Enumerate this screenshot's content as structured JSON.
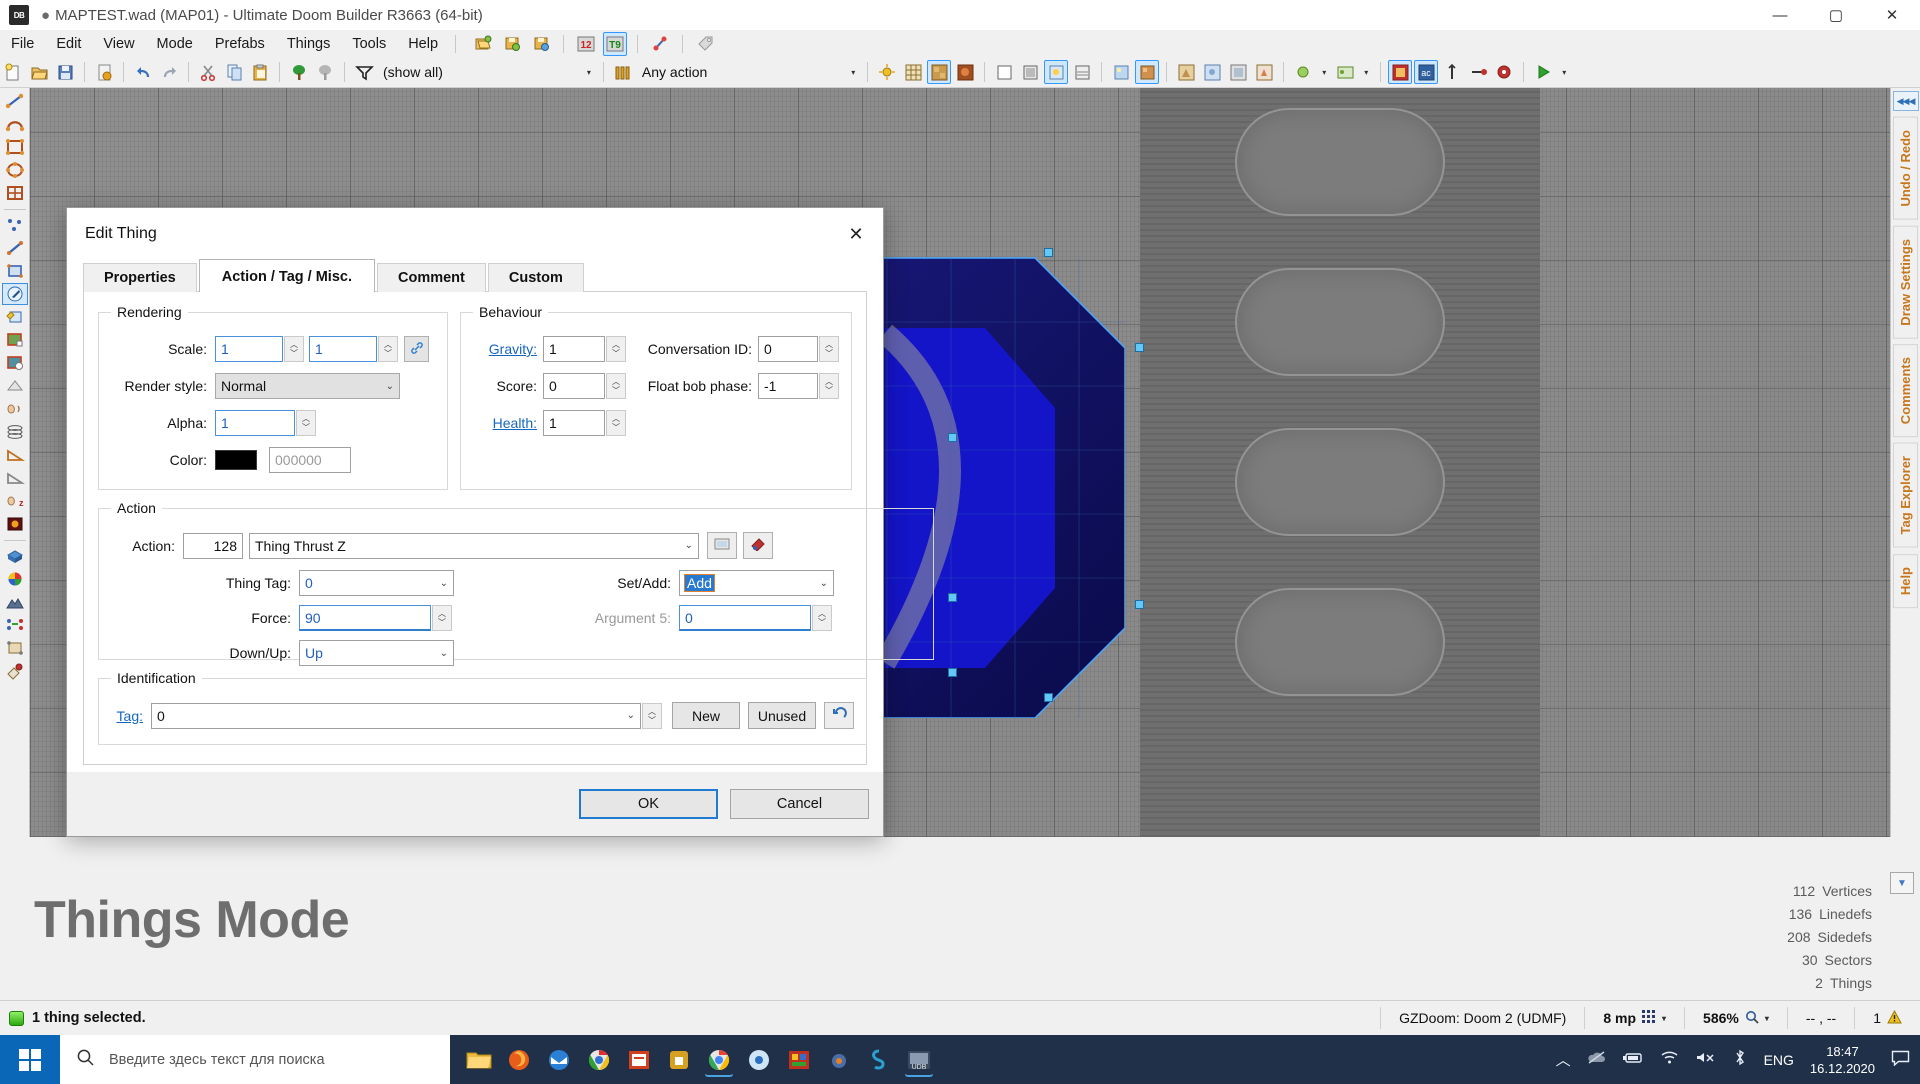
{
  "window": {
    "title": "MAPTEST.wad (MAP01) - Ultimate Doom Builder R3663 (64-bit)",
    "modified_dot": "●",
    "app_badge": "DB",
    "minimize": "—",
    "maximize": "▢",
    "close": "✕"
  },
  "menu": {
    "items": [
      "File",
      "Edit",
      "View",
      "Mode",
      "Prefabs",
      "Things",
      "Tools",
      "Help"
    ],
    "icons": [
      "open-map-icon",
      "save-map-icon",
      "save-map-as-icon",
      "linedefs-mode-icon",
      "things-mode-icon",
      "vertices-mode-icon",
      "tag-icon"
    ]
  },
  "toolbar": {
    "filter_label": "(show all)",
    "action_label": "Any action",
    "icons": [
      "new-map-icon",
      "open-map-icon",
      "save-map-icon",
      "map-options-icon",
      "undo-icon",
      "redo-icon",
      "cut-icon",
      "copy-icon",
      "paste-icon",
      "snap-to-grid-icon",
      "snap-to-things-icon",
      "filter-icon"
    ]
  },
  "left_rail": {
    "tools": [
      "draw-line-icon",
      "draw-curve-icon",
      "draw-rectangle-icon",
      "draw-ellipse-icon",
      "draw-grid-icon",
      "vertices-mode-icon",
      "linedefs-mode-icon",
      "sectors-mode-icon",
      "things-mode-icon",
      "edit-selection-icon",
      "texture-align-x-icon",
      "texture-align-y-icon",
      "flip-icon",
      "sound-propagation-icon",
      "3d-floors-icon",
      "slope-icon",
      "slope-vertices-icon",
      "sound-environment-icon",
      "brightness-icon",
      "visual-mode-icon",
      "color-picker-icon",
      "terrain-icon",
      "copy-properties-icon",
      "resize-icon",
      "stitch-icon"
    ],
    "active_tool": "things-mode-icon"
  },
  "right_rail": {
    "collapse_label": "◀◀◀",
    "tabs": [
      "Undo / Redo",
      "Draw Settings",
      "Comments",
      "Tag Explorer",
      "Help"
    ]
  },
  "map": {
    "mode_text": "Things Mode"
  },
  "counts": [
    {
      "value": "112",
      "label": "Vertices"
    },
    {
      "value": "136",
      "label": "Linedefs"
    },
    {
      "value": "208",
      "label": "Sidedefs"
    },
    {
      "value": "30",
      "label": "Sectors"
    },
    {
      "value": "2",
      "label": "Things"
    }
  ],
  "statusbar": {
    "message": "1 thing selected.",
    "config": "GZDoom: Doom 2 (UDMF)",
    "grid": "8 mp",
    "zoom": "586%",
    "coords": "-- , --",
    "warnings": "1"
  },
  "taskbar": {
    "search_placeholder": "Введите здесь текст для поиска",
    "apps": [
      "file-explorer-icon",
      "firefox-icon",
      "thunderbird-icon",
      "chromium-icon",
      "office-icon",
      "store-icon",
      "chrome-icon",
      "chrome-beta-icon",
      "slade-icon",
      "blender-icon",
      "sketch-icon",
      "doombuilder-icon"
    ],
    "language": "ENG",
    "time": "18:47",
    "date": "16.12.2020",
    "tray_icons": [
      "chevron-up-icon",
      "onedrive-icon",
      "battery-icon",
      "wifi-icon",
      "volume-muted-icon",
      "bluetooth-icon",
      "action-center-icon"
    ]
  },
  "dialog": {
    "title": "Edit Thing",
    "close": "✕",
    "tabs": [
      {
        "label": "Properties",
        "active": false
      },
      {
        "label": "Action / Tag / Misc.",
        "active": true
      },
      {
        "label": "Comment",
        "active": false
      },
      {
        "label": "Custom",
        "active": false
      }
    ],
    "rendering": {
      "legend": "Rendering",
      "scale_label": "Scale:",
      "scale_x": "1",
      "scale_y": "1",
      "link_icon": "link-icon",
      "render_style_label": "Render style:",
      "render_style_value": "Normal",
      "alpha_label": "Alpha:",
      "alpha_value": "1",
      "color_label": "Color:",
      "color_swatch": "#000000",
      "color_hex": "000000"
    },
    "behaviour": {
      "legend": "Behaviour",
      "gravity_label": "Gravity:",
      "gravity_value": "1",
      "score_label": "Score:",
      "score_value": "0",
      "health_label": "Health:",
      "health_value": "1",
      "conversation_label": "Conversation ID:",
      "conversation_value": "0",
      "floatbob_label": "Float bob phase:",
      "floatbob_value": "-1"
    },
    "action": {
      "legend": "Action",
      "action_label": "Action:",
      "action_number": "128",
      "action_name": "Thing Thrust Z",
      "browse_icon": "browse-action-icon",
      "palette_icon": "action-special-icon",
      "args": [
        {
          "label": "Thing Tag:",
          "value": "0",
          "type": "select",
          "dim": false,
          "highlight": false
        },
        {
          "label": "Force:",
          "value": "90",
          "type": "spin",
          "dim": false,
          "highlight": false
        },
        {
          "label": "Down/Up:",
          "value": "Up",
          "type": "select",
          "dim": false,
          "highlight": false
        }
      ],
      "args_right": [
        {
          "label": "Set/Add:",
          "value": "Add",
          "type": "select",
          "dim": false,
          "highlight": true
        },
        {
          "label": "Argument 5:",
          "value": "0",
          "type": "spin",
          "dim": true,
          "highlight": false
        }
      ]
    },
    "identification": {
      "legend": "Identification",
      "tag_label": "Tag:",
      "tag_value": "0",
      "new_button": "New",
      "unused_button": "Unused",
      "reset_icon": "reset-icon"
    },
    "footer": {
      "ok": "OK",
      "cancel": "Cancel"
    }
  }
}
